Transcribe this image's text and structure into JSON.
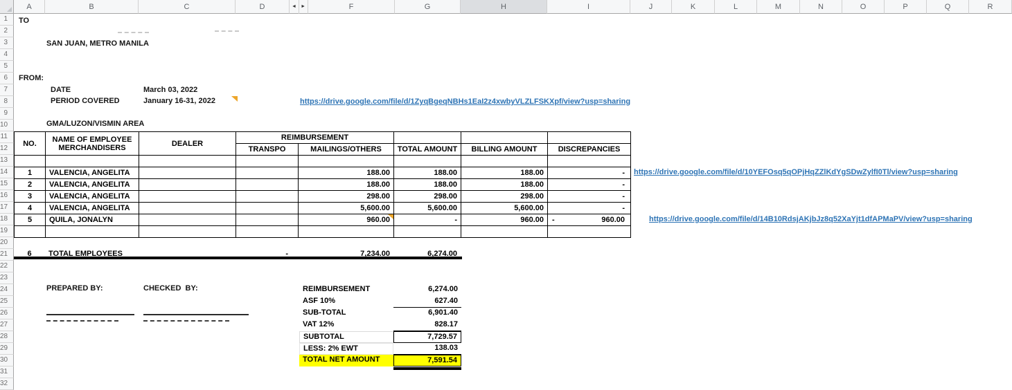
{
  "sheet": {
    "columns": [
      "A",
      "B",
      "C",
      "D",
      "F",
      "G",
      "H",
      "I",
      "J",
      "K",
      "L",
      "M",
      "N",
      "O",
      "P",
      "Q",
      "R"
    ],
    "selected_column": "H",
    "pane_arrows": {
      "left": "◄",
      "right": "►"
    },
    "rows": [
      "1",
      "2",
      "3",
      "4",
      "5",
      "6",
      "7",
      "8",
      "9",
      "10",
      "11",
      "12",
      "13",
      "14",
      "15",
      "16",
      "17",
      "18",
      "19",
      "20",
      "21",
      "22",
      "23",
      "24",
      "25",
      "26",
      "27",
      "28",
      "29",
      "30",
      "31",
      "32"
    ]
  },
  "header": {
    "to_label": "TO",
    "address": "SAN JUAN, METRO MANILA",
    "from_label": "FROM:",
    "date_label": "DATE",
    "date_value": "March 03, 2022",
    "period_label": "PERIOD COVERED",
    "period_value": "January 16-31, 2022",
    "area_title": "GMA/LUZON/VISMIN AREA"
  },
  "links": {
    "period_link": "https://drive.google.com/file/d/1ZyqBgeqNBHs1EaI2z4xwbyVLZLFSKXpf/view?usp=sharing",
    "row1_link": "https://drive.google.com/file/d/10YEFOsq5qOPjHqZZlKdYgSDwZylfI0Tl/view?usp=sharing",
    "row5_link": "https://drive.google.com/file/d/14B10RdsjAKjbJz8q52XaYjt1dfAPMaPV/view?usp=sharing"
  },
  "table": {
    "headers": {
      "no": "NO.",
      "name_line1": "NAME OF EMPLOYEE",
      "name_line2": "MERCHANDISERS",
      "dealer": "DEALER",
      "reimbursement": "REIMBURSEMENT",
      "transpo": "TRANSPO",
      "mailings": "MAILINGS/OTHERS",
      "total": "TOTAL AMOUNT",
      "billing": "BILLING AMOUNT",
      "discrepancies": "DISCREPANCIES"
    },
    "rows": [
      {
        "no": "1",
        "name": "VALENCIA, ANGELITA",
        "dealer": "",
        "transpo": "",
        "mailings": "188.00",
        "total": "188.00",
        "billing": "188.00",
        "disc_left": "",
        "disc_right": "-",
        "has_comment": false
      },
      {
        "no": "2",
        "name": "VALENCIA, ANGELITA",
        "dealer": "",
        "transpo": "",
        "mailings": "188.00",
        "total": "188.00",
        "billing": "188.00",
        "disc_left": "",
        "disc_right": "-",
        "has_comment": false
      },
      {
        "no": "3",
        "name": "VALENCIA, ANGELITA",
        "dealer": "",
        "transpo": "",
        "mailings": "298.00",
        "total": "298.00",
        "billing": "298.00",
        "disc_left": "",
        "disc_right": "-",
        "has_comment": false
      },
      {
        "no": "4",
        "name": "VALENCIA, ANGELITA",
        "dealer": "",
        "transpo": "",
        "mailings": "5,600.00",
        "total": "5,600.00",
        "billing": "5,600.00",
        "disc_left": "",
        "disc_right": "-",
        "has_comment": false
      },
      {
        "no": "5",
        "name": "QUILA, JONALYN",
        "dealer": "",
        "transpo": "",
        "mailings": "960.00",
        "total": "-",
        "billing": "960.00",
        "disc_left": "-",
        "disc_right": "960.00",
        "has_comment": true
      }
    ],
    "total_row": {
      "no": "6",
      "label": "TOTAL EMPLOYEES",
      "transpo": "-",
      "mailings": "7,234.00",
      "total": "6,274.00"
    }
  },
  "footer": {
    "prepared_label": "PREPARED BY:",
    "checked_label": "CHECKED  BY:",
    "summary": [
      {
        "label": "REIMBURSEMENT",
        "value": "6,274.00"
      },
      {
        "label": "ASF 10%",
        "value": "627.40"
      },
      {
        "label": "SUB-TOTAL",
        "value": "6,901.40"
      },
      {
        "label": "VAT 12%",
        "value": "828.17"
      },
      {
        "label": "SUBTOTAL",
        "value": "7,729.57"
      },
      {
        "label": "LESS: 2% EWT",
        "value": "138.03"
      },
      {
        "label": "TOTAL NET AMOUNT",
        "value": "7,591.54"
      }
    ]
  },
  "colors": {
    "link_blue": "#2e74b5",
    "discrepancy_red": "#e00000",
    "highlight_yellow": "#ffff00",
    "comment_flag_orange": "#eda62b"
  }
}
